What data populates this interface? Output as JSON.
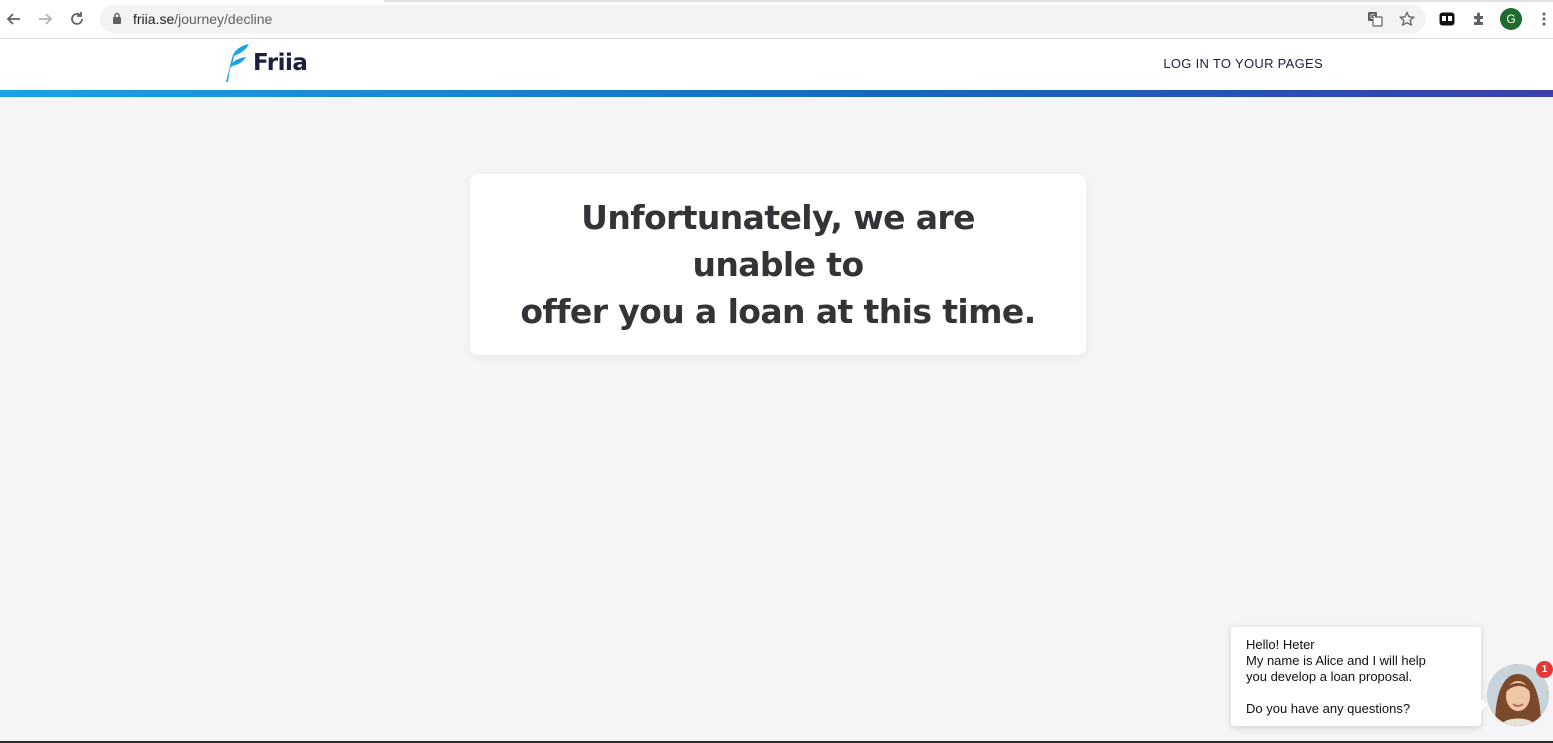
{
  "browser": {
    "url_domain": "friia.se",
    "url_path": "/journey/decline",
    "profile_initial": "G",
    "icons": [
      "back-icon",
      "forward-icon",
      "reload-icon",
      "lock-icon",
      "translate-icon",
      "star-icon",
      "extension-icon",
      "puzzle-icon",
      "more-icon"
    ]
  },
  "header": {
    "logo_text": "Friia",
    "login_label": "LOG IN TO YOUR PAGES"
  },
  "main": {
    "message_line1": "Unfortunately, we are unable to",
    "message_line2": "offer you a loan at this time."
  },
  "chat": {
    "greeting": "Hello! Heter",
    "line1": "My name is Alice and I will help",
    "line2": "you develop a loan proposal.",
    "question": "Do you have any questions?",
    "badge_count": "1"
  },
  "colors": {
    "brand_blue": "#1aa2e8",
    "brand_dark": "#1b1f3b",
    "accent_end": "#3b3fb0",
    "background": "#f5f5f7",
    "badge_red": "#e53935"
  }
}
